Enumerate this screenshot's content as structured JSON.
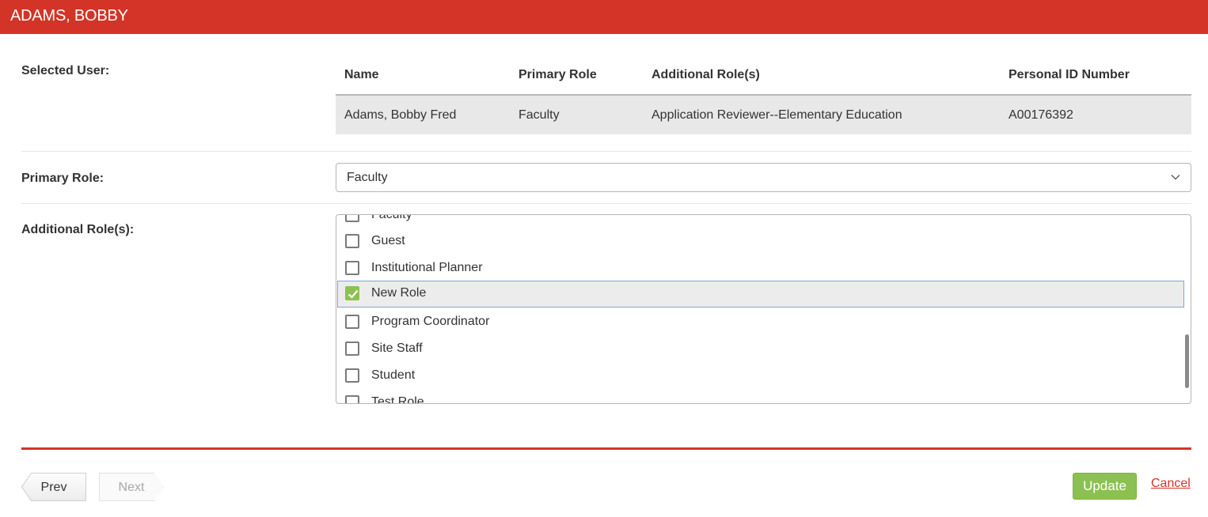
{
  "header": {
    "title": "ADAMS, BOBBY"
  },
  "labels": {
    "selected_user": "Selected User:",
    "primary_role": "Primary Role:",
    "additional_roles": "Additional Role(s):"
  },
  "user_table": {
    "columns": [
      "Name",
      "Primary Role",
      "Additional Role(s)",
      "Personal ID Number"
    ],
    "row": {
      "name": "Adams, Bobby Fred",
      "primary_role": "Faculty",
      "additional_roles": "Application Reviewer--Elementary Education",
      "personal_id": "A00176392"
    }
  },
  "primary_role_select": {
    "value": "Faculty",
    "icon": "chevron-down-icon"
  },
  "additional_roles_list": {
    "items": [
      {
        "label": "Faculty",
        "checked": false
      },
      {
        "label": "Guest",
        "checked": false
      },
      {
        "label": "Institutional Planner",
        "checked": false
      },
      {
        "label": "New Role",
        "checked": true,
        "selected": true
      },
      {
        "label": "Program Coordinator",
        "checked": false
      },
      {
        "label": "Site Staff",
        "checked": false
      },
      {
        "label": "Student",
        "checked": false
      },
      {
        "label": "Test Role",
        "checked": false
      }
    ]
  },
  "footer": {
    "prev_label": "Prev",
    "next_label": "Next",
    "update_label": "Update",
    "cancel_label": "Cancel"
  },
  "colors": {
    "brand_red": "#d33427",
    "check_green": "#8cc152",
    "row_gray": "#e8e8e8"
  }
}
